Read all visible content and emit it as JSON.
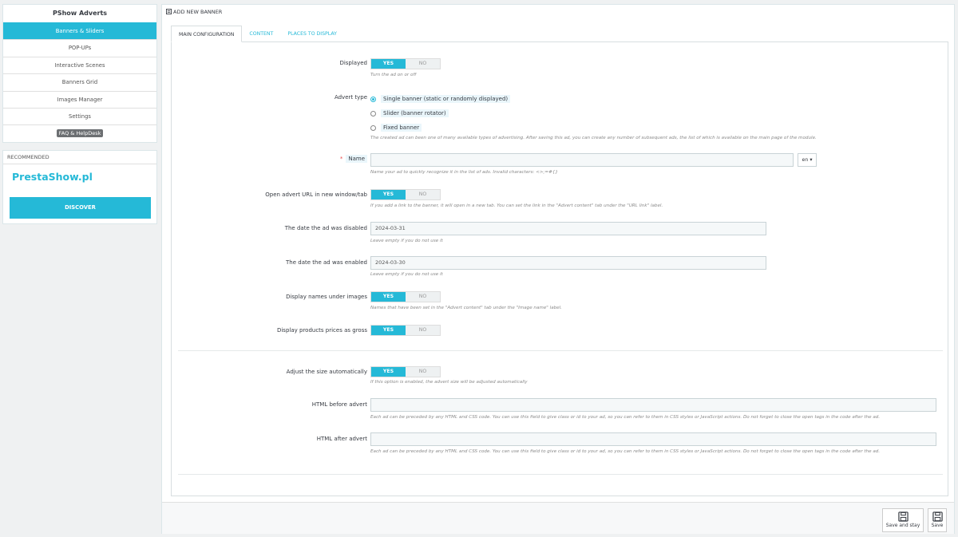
{
  "sidebar": {
    "title": "PShow Adverts",
    "items": [
      {
        "label": "Banners & Sliders",
        "active": true
      },
      {
        "label": "POP-UPs"
      },
      {
        "label": "Interactive Scenes"
      },
      {
        "label": "Banners Grid"
      },
      {
        "label": "Images Manager"
      },
      {
        "label": "Settings"
      },
      {
        "label": "FAQ & HelpDesk",
        "badge": true
      }
    ],
    "recommended": {
      "heading": "RECOMMENDED",
      "brand": "PrestaShow.pl",
      "button": "DISCOVER"
    }
  },
  "panel": {
    "title": "ADD NEW BANNER",
    "tabs": [
      {
        "label": "MAIN CONFIGURATION",
        "active": true
      },
      {
        "label": "CONTENT"
      },
      {
        "label": "PLACES TO DISPLAY"
      }
    ]
  },
  "toggle": {
    "yes": "YES",
    "no": "NO"
  },
  "form": {
    "displayed": {
      "label": "Displayed",
      "help": "Turn the ad on or off"
    },
    "advert_type": {
      "label": "Advert type",
      "options": [
        "Single banner (static or randomly displayed)",
        "Slider (banner rotator)",
        "Fixed banner"
      ],
      "selected": 0,
      "help": "The created ad can been one of many available types of advertising. After saving this ad, you can create any number of subsequent ads, the list of which is available on the main page of the module."
    },
    "name": {
      "required": "*",
      "label": "Name",
      "value": "",
      "lang": "en ▾",
      "help": "Name your ad to quickly recognize it in the list of ads. Invalid characters: <>;=#{}"
    },
    "new_window": {
      "label": "Open advert URL in new window/tab",
      "help": "If you add a link to the banner, it will open in a new tab. You can set the link in the \"Advert content\" tab under the \"URL link\" label."
    },
    "date_disabled": {
      "label": "The date the ad was disabled",
      "value": "2024-03-31",
      "help": "Leave empty if you do not use it"
    },
    "date_enabled": {
      "label": "The date the ad was enabled",
      "value": "2024-03-30",
      "help": "Leave empty if you do not use it"
    },
    "display_names": {
      "label": "Display names under images",
      "help": "Names that have been set in the \"Advert content\" tab under the \"Image name\" label."
    },
    "display_prices": {
      "label": "Display products prices as gross"
    },
    "adjust_size": {
      "label": "Adjust the size automatically",
      "help": "If this option is enabled, the advert size will be adjusted automatically"
    },
    "html_before": {
      "label": "HTML before advert",
      "value": "",
      "help": "Each ad can be preceded by any HTML and CSS code. You can use this field to give class or id to your ad, so you can refer to them in CSS styles or JavaScript actions. Do not forget to close the open tags in the code after the ad."
    },
    "html_after": {
      "label": "HTML after advert",
      "value": "",
      "help": "Each ad can be preceded by any HTML and CSS code. You can use this field to give class or id to your ad, so you can refer to them in CSS styles or JavaScript actions. Do not forget to close the open tags in the code after the ad."
    }
  },
  "footer": {
    "save_and_stay": "Save and stay",
    "save": "Save"
  },
  "colors": {
    "accent": "#25b9d7",
    "background": "#eff1f2",
    "required": "#e84e4e"
  }
}
